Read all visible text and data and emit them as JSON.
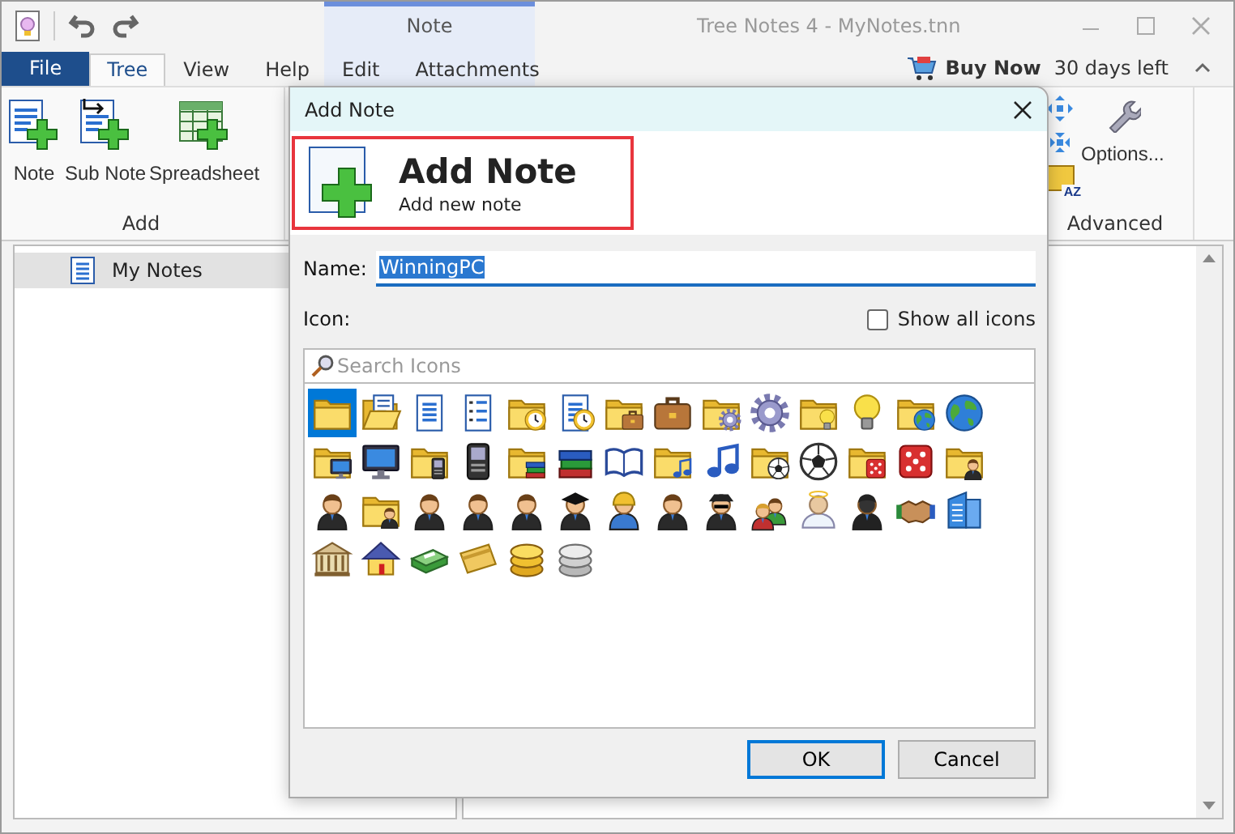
{
  "window": {
    "title": "Tree Notes 4 - MyNotes.tnn"
  },
  "context_group": {
    "label": "Note"
  },
  "tabs": [
    {
      "label": "File",
      "kind": "file",
      "selected": false
    },
    {
      "label": "Tree",
      "kind": "tab",
      "selected": true
    },
    {
      "label": "View",
      "kind": "tab",
      "selected": false
    },
    {
      "label": "Help",
      "kind": "tab",
      "selected": false
    },
    {
      "label": "Edit",
      "kind": "context",
      "selected": false
    },
    {
      "label": "Attachments",
      "kind": "context",
      "selected": false
    }
  ],
  "buy": {
    "label": "Buy Now",
    "trial": "30 days left"
  },
  "ribbon": {
    "add_group": {
      "label": "Add",
      "buttons": [
        {
          "label": "Note",
          "kind": "note"
        },
        {
          "label": "Sub Note",
          "kind": "sub-note"
        },
        {
          "label": "Spreadsheet",
          "kind": "spreadsheet"
        }
      ]
    },
    "advanced_group": {
      "label": "Advanced",
      "small_buttons": [
        {
          "kind": "expand"
        },
        {
          "kind": "collapse"
        },
        {
          "kind": "sort",
          "text": "AZ"
        }
      ],
      "buttons": [
        {
          "label": "Options...",
          "kind": "options"
        }
      ]
    }
  },
  "tree": {
    "items": [
      {
        "label": "My Notes",
        "selected": true
      }
    ]
  },
  "dialog": {
    "title": "Add Note",
    "heading": "Add Note",
    "subheading": "Add new note",
    "name_label": "Name:",
    "name_value": "WinningPC",
    "icon_label": "Icon:",
    "show_all": {
      "label": "Show all icons",
      "checked": false
    },
    "search": {
      "placeholder": "Search Icons"
    },
    "icons": [
      {
        "kind": "folder",
        "selected": true
      },
      {
        "kind": "open-folder",
        "selected": false
      },
      {
        "kind": "document",
        "selected": false
      },
      {
        "kind": "list",
        "selected": false
      },
      {
        "kind": "folder-clock",
        "selected": false
      },
      {
        "kind": "document-clock",
        "selected": false
      },
      {
        "kind": "folder-briefcase",
        "selected": false
      },
      {
        "kind": "briefcase",
        "selected": false
      },
      {
        "kind": "folder-gear",
        "selected": false
      },
      {
        "kind": "gear",
        "selected": false
      },
      {
        "kind": "folder-bulb",
        "selected": false
      },
      {
        "kind": "bulb",
        "selected": false
      },
      {
        "kind": "folder-globe",
        "selected": false
      },
      {
        "kind": "globe",
        "selected": false
      },
      {
        "kind": "folder-monitor",
        "selected": false
      },
      {
        "kind": "monitor",
        "selected": false
      },
      {
        "kind": "folder-phone",
        "selected": false
      },
      {
        "kind": "phone",
        "selected": false
      },
      {
        "kind": "folder-books",
        "selected": false
      },
      {
        "kind": "books",
        "selected": false
      },
      {
        "kind": "book",
        "selected": false
      },
      {
        "kind": "folder-music",
        "selected": false
      },
      {
        "kind": "music",
        "selected": false
      },
      {
        "kind": "folder-ball",
        "selected": false
      },
      {
        "kind": "ball",
        "selected": false
      },
      {
        "kind": "folder-dice",
        "selected": false
      },
      {
        "kind": "dice",
        "selected": false
      },
      {
        "kind": "folder-person",
        "selected": false
      },
      {
        "kind": "person",
        "selected": false
      },
      {
        "kind": "folder-person",
        "selected": false
      },
      {
        "kind": "person",
        "selected": false
      },
      {
        "kind": "person",
        "selected": false
      },
      {
        "kind": "person",
        "selected": false
      },
      {
        "kind": "graduate",
        "selected": false
      },
      {
        "kind": "worker",
        "selected": false
      },
      {
        "kind": "person",
        "selected": false
      },
      {
        "kind": "agent",
        "selected": false
      },
      {
        "kind": "people",
        "selected": false
      },
      {
        "kind": "angel",
        "selected": false
      },
      {
        "kind": "shadow-person",
        "selected": false
      },
      {
        "kind": "handshake",
        "selected": false
      },
      {
        "kind": "building",
        "selected": false
      },
      {
        "kind": "bank",
        "selected": false
      },
      {
        "kind": "house",
        "selected": false
      },
      {
        "kind": "money",
        "selected": false
      },
      {
        "kind": "card",
        "selected": false
      },
      {
        "kind": "coins",
        "selected": false
      },
      {
        "kind": "silver-coins",
        "selected": false
      }
    ],
    "buttons": [
      {
        "label": "OK",
        "default": true
      },
      {
        "label": "Cancel",
        "default": false
      }
    ]
  }
}
